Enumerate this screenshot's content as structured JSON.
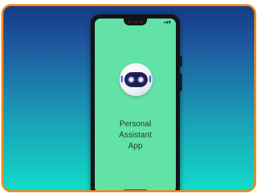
{
  "screen": {
    "title_lines": [
      "Personal",
      "Assistant",
      "App"
    ]
  },
  "icons": {
    "logo": "robot-head-icon",
    "camera": "front-camera-icon"
  },
  "colors": {
    "frame_border": "#f08a1c",
    "background_top": "#163a86",
    "background_bottom": "#12dbc9",
    "phone_body": "#121417",
    "screen_background": "#62e2a6",
    "title_text": "#1f3a30",
    "robot_eye": "#8a6cff"
  }
}
